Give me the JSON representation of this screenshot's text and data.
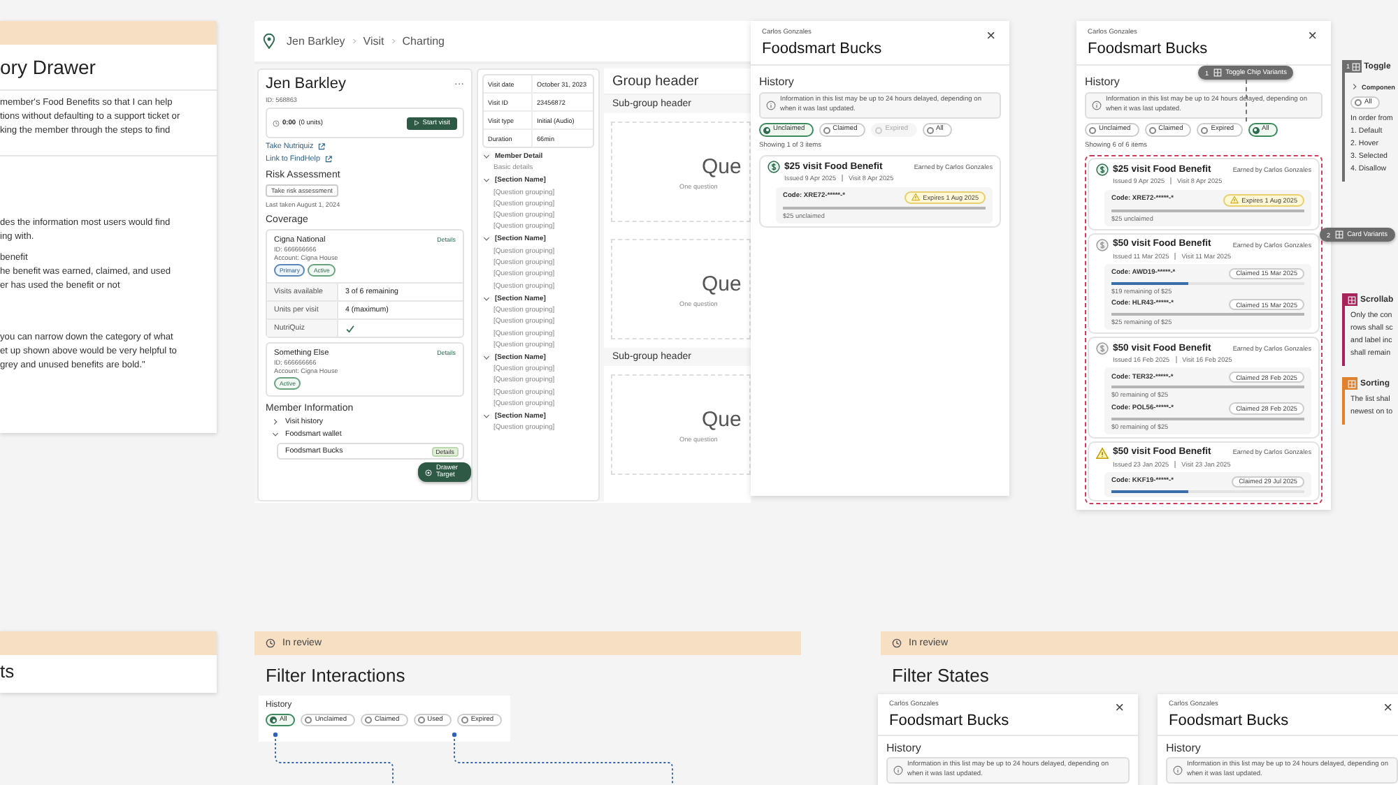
{
  "doc_card": {
    "title": "ory Drawer",
    "paragraphs": [
      [
        "member's Food Benefits so that I can help",
        "tions without defaulting to a support ticket or",
        "king the member through the steps to find"
      ],
      [
        "des the information most users would find",
        "ing with."
      ],
      [
        "benefit",
        "he benefit was earned, claimed, and used",
        "er has used the benefit or not"
      ],
      [
        "you can narrow down the category of what",
        "et up shown above would be very helpful to",
        "grey and unused benefits are bold.\""
      ]
    ]
  },
  "charting": {
    "breadcrumb": [
      "Jen Barkley",
      "Visit",
      "Charting"
    ],
    "member": {
      "name": "Jen Barkley",
      "more": "···",
      "id": "ID: 568863"
    },
    "timer": {
      "time": "0:00",
      "units": "(0 units)",
      "button": "Start visit"
    },
    "links": [
      "Take Nutriquiz",
      "Link to FindHelp"
    ],
    "risk": {
      "heading": "Risk Assessment",
      "button": "Take risk assessment",
      "last_taken": "Last taken August 1, 2024"
    },
    "coverage": {
      "heading": "Coverage",
      "plans": [
        {
          "name": "Cigna National",
          "details": "Details",
          "id": "ID: 666666666",
          "account": "Account: Cigna House",
          "badges": [
            {
              "label": "Primary",
              "kind": "primary"
            },
            {
              "label": "Active",
              "kind": "active"
            }
          ],
          "rows": [
            {
              "label": "Visits available",
              "value": "3 of 6 remaining"
            },
            {
              "label": "Units per visit",
              "value": "4 (maximum)"
            },
            {
              "label": "NutriQuiz",
              "checked": true
            }
          ]
        },
        {
          "name": "Something Else",
          "details": "Details",
          "id": "ID: 666666666",
          "account": "Account: Cigna House",
          "badges": [
            {
              "label": "Active",
              "kind": "active"
            }
          ]
        }
      ]
    },
    "member_info": {
      "heading": "Member Information",
      "tree": [
        {
          "label": "Visit history",
          "expanded": false
        },
        {
          "label": "Foodsmart wallet",
          "expanded": true,
          "children": [
            {
              "label": "Foodsmart Bucks",
              "action": "Details"
            }
          ]
        }
      ]
    },
    "drawer_target": "Drawer Target",
    "visit_info": [
      {
        "label": "Visit date",
        "value": "October 31, 2023"
      },
      {
        "label": "Visit ID",
        "value": "23456872"
      },
      {
        "label": "Visit type",
        "value": "Initial (Audio)"
      },
      {
        "label": "Duration",
        "value": "66min"
      }
    ],
    "outline": [
      {
        "label": "Member Detail",
        "expanded": true,
        "children": [
          "Basic details"
        ]
      },
      {
        "label": "[Section Name]",
        "expanded": true,
        "children": [
          "[Question grouping]",
          "[Question grouping]",
          "[Question grouping]",
          "[Question grouping]"
        ]
      },
      {
        "label": "[Section Name]",
        "expanded": true,
        "children": [
          "[Question grouping]",
          "[Question grouping]",
          "[Question grouping]",
          "[Question grouping]"
        ]
      },
      {
        "label": "[Section Name]",
        "expanded": true,
        "children": [
          "[Question grouping]",
          "[Question grouping]",
          "[Question grouping]",
          "[Question grouping]"
        ]
      },
      {
        "label": "[Section Name]",
        "expanded": true,
        "children": [
          "[Question grouping]",
          "[Question grouping]",
          "[Question grouping]",
          "[Question grouping]"
        ]
      },
      {
        "label": "[Section Name]",
        "expanded": true,
        "children": [
          "[Question grouping]"
        ]
      }
    ],
    "form": {
      "group_header": "Group header",
      "sections": [
        {
          "header": "Sub-group header",
          "questions": [
            {
              "title": "Que",
              "subtitle": "One question"
            },
            {
              "title": "Que",
              "subtitle": "One question"
            }
          ]
        },
        {
          "header": "Sub-group header",
          "questions": [
            {
              "title": "Que",
              "subtitle": "One question"
            }
          ]
        }
      ]
    }
  },
  "drawers": [
    {
      "person": "Carlos Gonzales",
      "title": "Foodsmart Bucks",
      "close": "×",
      "history": "History",
      "info": "Information in this list may be up to 24 hours delayed, depending on when it was last updated.",
      "chips": [
        {
          "label": "Unclaimed",
          "selected": true,
          "disabled": false
        },
        {
          "label": "Claimed",
          "selected": false,
          "disabled": false
        },
        {
          "label": "Expired",
          "selected": false,
          "disabled": true
        },
        {
          "label": "All",
          "selected": false,
          "disabled": false
        }
      ],
      "showing": "Showing 1 of 3 items",
      "cards": [
        {
          "kind": "active",
          "title": "$25 visit Food Benefit",
          "earned": "Earned by Carlos Gonzales",
          "issued": "Issued 9 Apr 2025",
          "visit": "Visit 8 Apr 2025",
          "codes": [
            {
              "code": "Code: XRE72-*****-*",
              "status": "Expires 1 Aug 2025",
              "kind": "expires",
              "remaining": "$25 unclaimed"
            }
          ]
        }
      ]
    },
    {
      "person": "Carlos Gonzales",
      "title": "Foodsmart Bucks",
      "close": "×",
      "history": "History",
      "info": "Information in this list may be up to 24 hours delayed, depending on when it was last updated.",
      "chips": [
        {
          "label": "Unclaimed",
          "selected": false
        },
        {
          "label": "Claimed",
          "selected": false
        },
        {
          "label": "Expired",
          "selected": false
        },
        {
          "label": "All",
          "selected": true
        }
      ],
      "showing": "Showing 6 of 6 items",
      "cards": [
        {
          "kind": "active",
          "title": "$25 visit Food Benefit",
          "earned": "Earned by Carlos Gonzales",
          "issued": "Issued 9 Apr 2025",
          "visit": "Visit 8 Apr 2025",
          "codes": [
            {
              "code": "Code: XRE72-*****-*",
              "status": "Expires 1 Aug 2025",
              "kind": "expires",
              "remaining": "$25 unclaimed"
            }
          ]
        },
        {
          "kind": "inactive",
          "title": "$50 visit Food Benefit",
          "earned": "Earned by Carlos Gonzales",
          "issued": "Issued 11 Mar 2025",
          "visit": "Visit 11 Mar 2025",
          "codes": [
            {
              "code": "Code: AWD19-*****-*",
              "status": "Claimed 15 Mar 2025",
              "kind": "claimed",
              "level": 0.4,
              "remaining": "$19 remaining of $25"
            },
            {
              "code": "Code: HLR43-*****-*",
              "status": "Claimed 15 Mar 2025",
              "kind": "claimed",
              "remaining": "$25 remaining of $25"
            }
          ]
        },
        {
          "kind": "inactive",
          "title": "$50 visit Food Benefit",
          "earned": "Earned by Carlos Gonzales",
          "issued": "Issued 16 Feb 2025",
          "visit": "Visit 16 Feb 2025",
          "codes": [
            {
              "code": "Code: TER32-*****-*",
              "status": "Claimed 28 Feb 2025",
              "kind": "claimed",
              "remaining": "$0 remaining of $25"
            },
            {
              "code": "Code: POL56-*****-*",
              "status": "Claimed 28 Feb 2025",
              "kind": "claimed",
              "remaining": "$0 remaining of $25"
            }
          ]
        },
        {
          "kind": "warning",
          "title": "$50 visit Food Benefit",
          "earned": "Earned by Carlos Gonzales",
          "issued": "Issued 23 Jan 2025",
          "visit": "Visit 23 Jan 2025",
          "codes": [
            {
              "code": "Code: KKF19-*****-*",
              "status": "Claimed 29 Jul 2025",
              "kind": "claimed",
              "level": 0.4
            }
          ]
        }
      ]
    }
  ],
  "annotations": [
    {
      "number": "1",
      "label": "Toggle Chip Variants"
    },
    {
      "number": "2",
      "label": "Card Variants"
    }
  ],
  "side_notes": [
    {
      "number": "1",
      "title": "Toggle",
      "color": "#6e6e6e",
      "component": "Componen",
      "chips": [
        "All"
      ],
      "lines": [
        "In order from",
        "1. Default",
        "2. Hover",
        "3. Selected",
        "4. Disallow"
      ]
    },
    {
      "title": "Scrollab",
      "color": "#a8235a",
      "lines": [
        "Only the con",
        "rows shall sc",
        "and label inc",
        "shall remain"
      ]
    },
    {
      "title": "Sorting",
      "color": "#e0812e",
      "lines": [
        "The list shal",
        "newest on to"
      ]
    }
  ],
  "bottom_doc": {
    "title": "ts"
  },
  "review_frames": [
    {
      "status": "In review",
      "title": "Filter Interactions"
    },
    {
      "status": "In review",
      "title": "Filter States"
    }
  ],
  "filter_demo": {
    "label": "History",
    "chips": [
      {
        "label": "All",
        "selected": true
      },
      {
        "label": "Unclaimed",
        "selected": false
      },
      {
        "label": "Claimed",
        "selected": false
      },
      {
        "label": "Used",
        "selected": false
      },
      {
        "label": "Expired",
        "selected": false
      }
    ]
  },
  "state_drawers": [
    {
      "person": "Carlos Gonzales",
      "title": "Foodsmart Bucks",
      "close": "×",
      "history": "History",
      "info": "Information in this list may be up to 24 hours delayed, depending on when it was last updated."
    },
    {
      "person": "Carlos Gonzales",
      "title": "Foodsmart Bucks",
      "close": "×",
      "history": "History",
      "info": "Information in this list may be up to 24 hours delayed, depending on when it was last updated."
    }
  ]
}
